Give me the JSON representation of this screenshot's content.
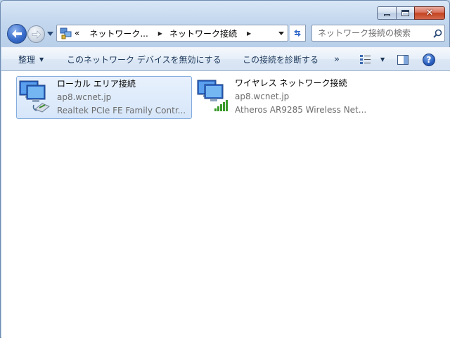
{
  "window": {
    "caption_close_glyph": "✕"
  },
  "navbar": {
    "address_root": "«",
    "breadcrumbs": [
      {
        "label": "ネットワーク..."
      },
      {
        "label": "ネットワーク接続"
      }
    ],
    "search_placeholder": "ネットワーク接続の検索"
  },
  "commandbar": {
    "organize_label": "整理",
    "disable_label": "このネットワーク デバイスを無効にする",
    "diagnose_label": "この接続を診断する",
    "more_label": "»",
    "help_label": "?"
  },
  "connections": [
    {
      "name": "ローカル エリア接続",
      "network": "ap8.wcnet.jp",
      "adapter": "Realtek PCIe FE Family Contr...",
      "selected": true,
      "type": "wired"
    },
    {
      "name": "ワイヤレス ネットワーク接続",
      "network": "ap8.wcnet.jp",
      "adapter": "Atheros AR9285 Wireless Net...",
      "selected": false,
      "type": "wireless",
      "signal_bars": 5
    }
  ],
  "colors": {
    "accent": "#1e395b",
    "selection_border": "#84acdd",
    "signal_green": "#3a9a2a"
  }
}
